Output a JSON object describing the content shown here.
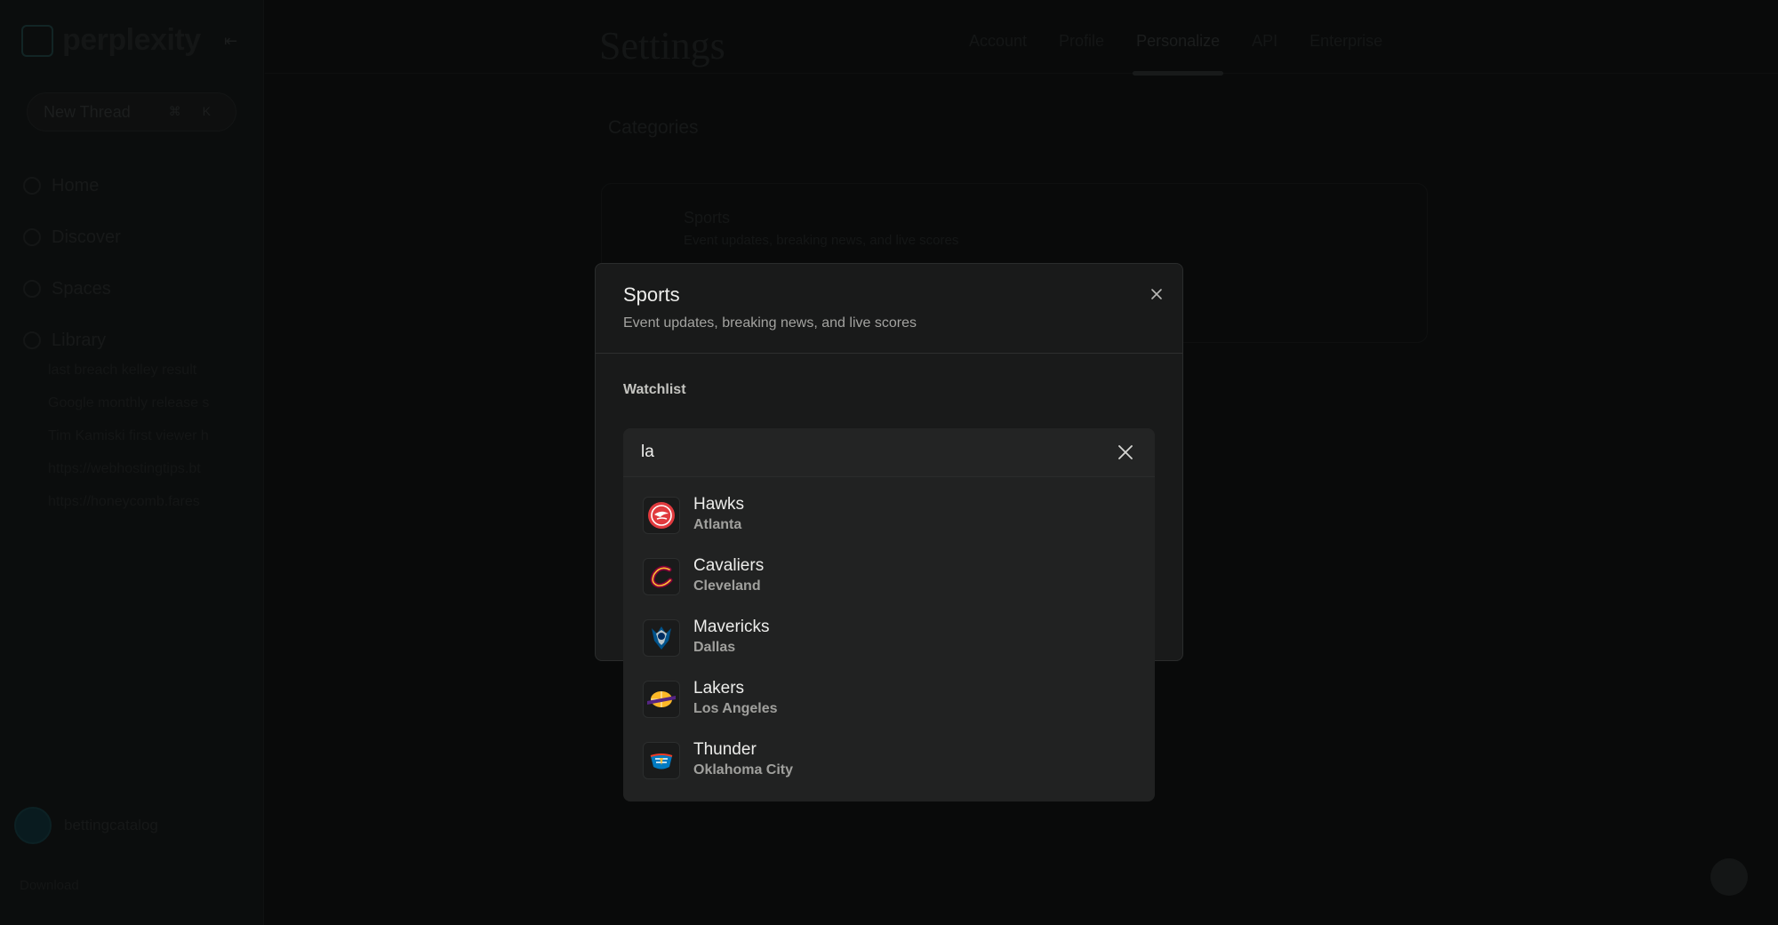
{
  "app": {
    "brand": "perplexity",
    "new_thread_label": "New Thread",
    "new_thread_keys": "⌘ K",
    "nav": [
      "Home",
      "Discover",
      "Spaces",
      "Library"
    ],
    "library_items": [
      "last breach kelley result",
      "Google monthly release s",
      "Tim Kamiski first viewer h",
      "https://webhostingtips.bt",
      "https://honeycomb.fares"
    ],
    "username": "bettingcatalog",
    "bottom_label": "Download"
  },
  "settings": {
    "title": "Settings",
    "tabs": [
      "Account",
      "Profile",
      "Personalize",
      "API",
      "Enterprise"
    ],
    "active_tab": "Personalize",
    "categories_title": "Categories",
    "category_name": "Sports",
    "category_desc": "Event updates, breaking news, and live scores"
  },
  "modal": {
    "title": "Sports",
    "subtitle": "Event updates, breaking news, and live scores",
    "watchlist_label": "Watchlist",
    "search_value": "la",
    "teams": [
      {
        "name": "Hawks",
        "city": "Atlanta",
        "logo": "hawks-logo"
      },
      {
        "name": "Cavaliers",
        "city": "Cleveland",
        "logo": "cavaliers-logo"
      },
      {
        "name": "Mavericks",
        "city": "Dallas",
        "logo": "mavericks-logo"
      },
      {
        "name": "Lakers",
        "city": "Los Angeles",
        "logo": "lakers-logo"
      },
      {
        "name": "Thunder",
        "city": "Oklahoma City",
        "logo": "thunder-logo"
      }
    ]
  },
  "colors": {
    "hawks": "#e03a3e",
    "cavaliers": "#860038",
    "cavaliers_gold": "#fdbb30",
    "mavericks": "#00538c",
    "lakers_purple": "#552583",
    "lakers_gold": "#fdb927",
    "thunder_blue": "#007ac1",
    "thunder_orange": "#ef3b24"
  }
}
